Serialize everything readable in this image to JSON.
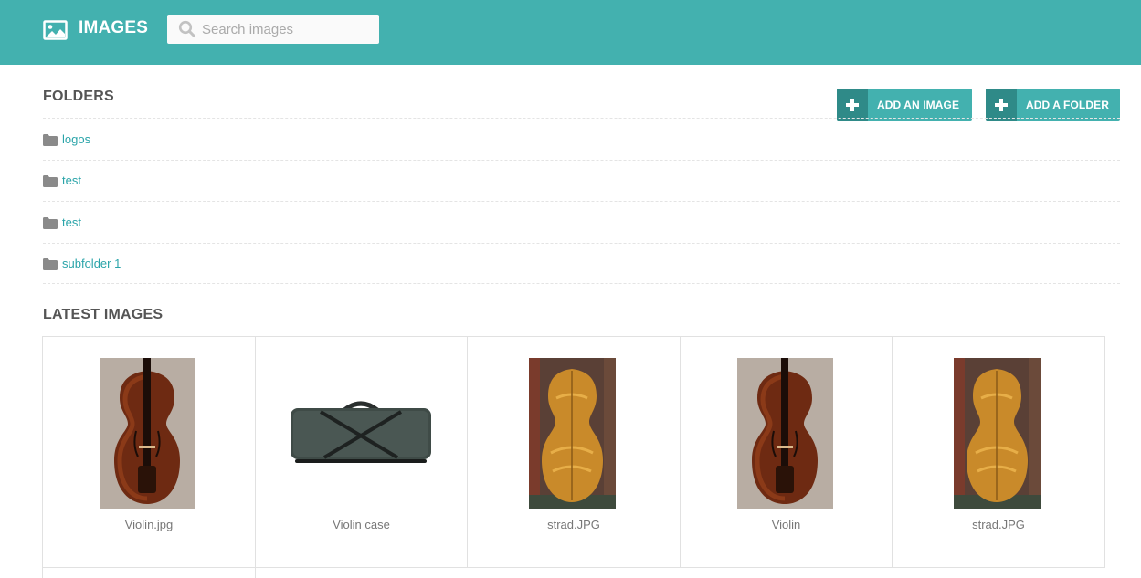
{
  "header": {
    "title": "IMAGES",
    "brand_icon": "image-icon",
    "search_placeholder": "Search images",
    "search_icon": "search-icon"
  },
  "colors": {
    "accent": "#43b1af",
    "accent_dark": "#2f8a88",
    "link": "#2aa4a9"
  },
  "actions": {
    "add_image": "ADD AN IMAGE",
    "add_folder": "ADD A FOLDER",
    "icon": "plus-icon"
  },
  "folders": {
    "title": "FOLDERS",
    "items": [
      {
        "label": "logos"
      },
      {
        "label": "test"
      },
      {
        "label": "test"
      },
      {
        "label": "subfolder 1"
      }
    ]
  },
  "latest": {
    "title": "LATEST IMAGES",
    "items": [
      {
        "caption": "Violin.jpg",
        "thumb": "violin-front"
      },
      {
        "caption": "Violin case",
        "thumb": "violin-case"
      },
      {
        "caption": "strad.JPG",
        "thumb": "violin-back"
      },
      {
        "caption": "Violin",
        "thumb": "violin-front"
      },
      {
        "caption": "strad.JPG",
        "thumb": "violin-back"
      }
    ]
  }
}
